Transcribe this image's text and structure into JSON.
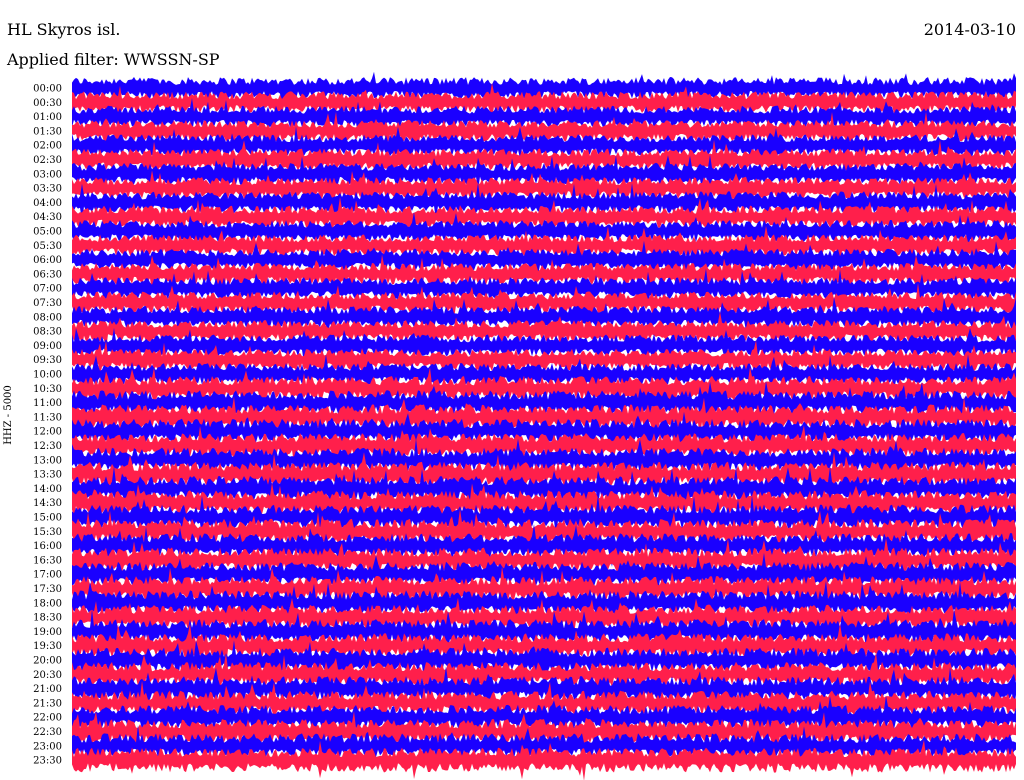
{
  "header": {
    "station": "HL Skyros isl.",
    "date": "2014-03-10",
    "filter": "Applied filter: WWSSN-SP"
  },
  "chart_data": {
    "type": "line",
    "title": "HL Skyros isl.",
    "subtitle": "Applied filter: WWSSN-SP",
    "ylabel": "HHZ - 5000",
    "rows": [
      "00:00",
      "00:30",
      "01:00",
      "01:30",
      "02:00",
      "02:30",
      "03:00",
      "03:30",
      "04:00",
      "04:30",
      "05:00",
      "05:30",
      "06:00",
      "06:30",
      "07:00",
      "07:30",
      "08:00",
      "08:30",
      "09:00",
      "09:30",
      "10:00",
      "10:30",
      "11:00",
      "11:30",
      "12:00",
      "12:30",
      "13:00",
      "13:30",
      "14:00",
      "14:30",
      "15:00",
      "15:30",
      "16:00",
      "16:30",
      "17:00",
      "17:30",
      "18:00",
      "18:30",
      "19:00",
      "19:30",
      "20:00",
      "20:30",
      "21:00",
      "21:30",
      "22:00",
      "22:30",
      "23:00",
      "23:30"
    ],
    "colors": [
      "#1a00ff",
      "#ff1f4b"
    ],
    "row_color_order": "alternating"
  }
}
